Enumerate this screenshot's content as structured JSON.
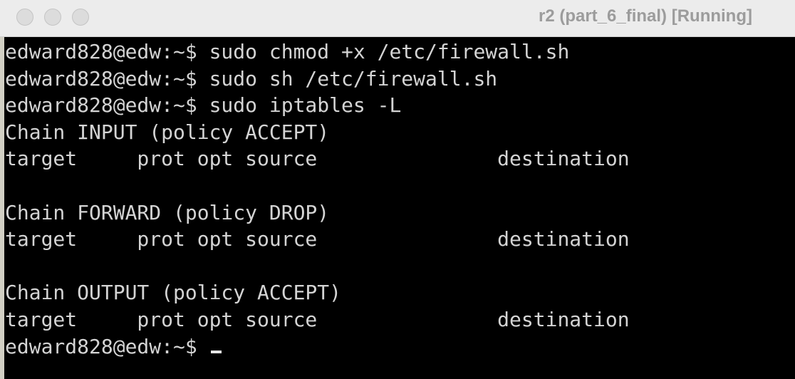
{
  "window": {
    "title": "r2 (part_6_final) [Running]"
  },
  "terminal": {
    "lines": [
      "edward828@edw:~$ sudo chmod +x /etc/firewall.sh",
      "edward828@edw:~$ sudo sh /etc/firewall.sh",
      "edward828@edw:~$ sudo iptables -L",
      "Chain INPUT (policy ACCEPT)",
      "target     prot opt source               destination",
      "",
      "Chain FORWARD (policy DROP)",
      "target     prot opt source               destination",
      "",
      "Chain OUTPUT (policy ACCEPT)",
      "target     prot opt source               destination"
    ],
    "prompt": "edward828@edw:~$ "
  }
}
